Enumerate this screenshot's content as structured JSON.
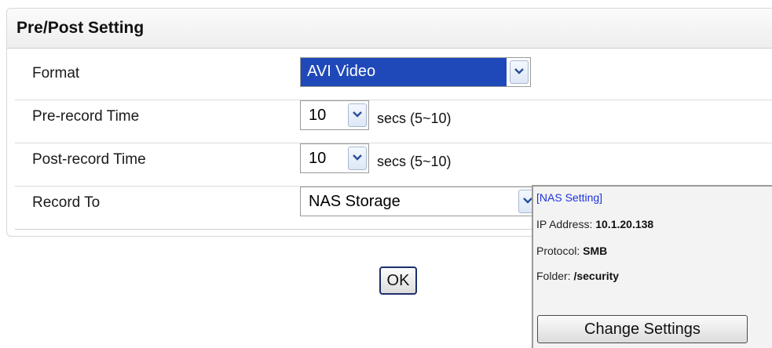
{
  "panel": {
    "title": "Pre/Post Setting"
  },
  "rows": [
    {
      "label": "Format",
      "value": "AVI Video",
      "hint": ""
    },
    {
      "label": "Pre-record Time",
      "value": "10",
      "hint": "secs (5~10)"
    },
    {
      "label": "Post-record Time",
      "value": "10",
      "hint": "secs (5~10)"
    },
    {
      "label": "Record To",
      "value": "NAS Storage",
      "hint": ""
    }
  ],
  "nas": {
    "title": "[NAS Setting]",
    "ip_label": "IP Address:",
    "ip_value": "10.1.20.138",
    "protocol_label": "Protocol:",
    "protocol_value": "SMB",
    "folder_label": "Folder:",
    "folder_value": "/security",
    "change_button": "Change Settings"
  },
  "ok_button": "OK",
  "icons": {
    "dropdown": "chevron-down-icon"
  },
  "colors": {
    "selection_highlight": "#1f48b8",
    "nas_title": "#1e33e0"
  }
}
